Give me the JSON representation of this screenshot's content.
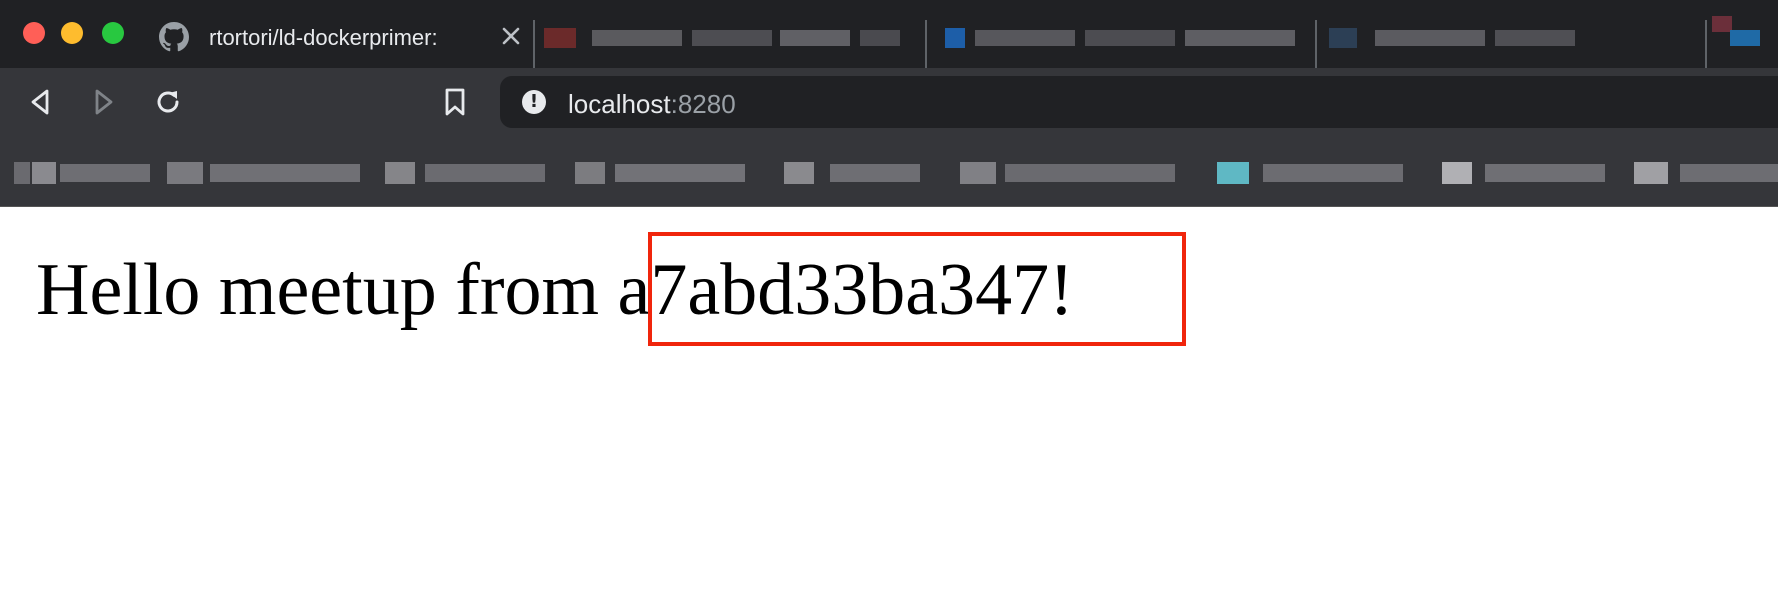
{
  "browser": {
    "active_tab": {
      "title": "rtortori/ld-dockerprimer:",
      "favicon": "github-icon",
      "close_icon": "close-icon"
    },
    "toolbar": {
      "back_icon": "back-arrow-icon",
      "forward_icon": "forward-arrow-icon",
      "reload_icon": "reload-icon",
      "bookmark_icon": "bookmark-icon",
      "security_icon": "info-icon",
      "url_host": "localhost",
      "url_port": ":8280"
    },
    "colors": {
      "close": "#ff5f57",
      "minimize": "#febc2e",
      "maximize": "#28c840",
      "highlight_box": "#f0250c"
    }
  },
  "page": {
    "headline": "Hello meetup from a7abd33ba347!"
  }
}
